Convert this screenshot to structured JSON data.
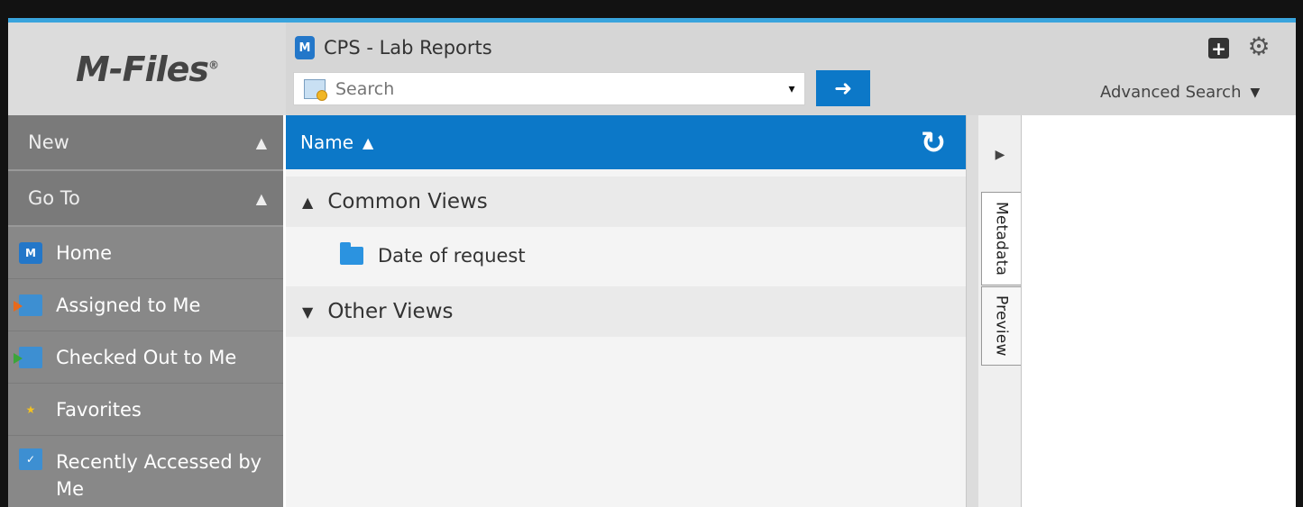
{
  "app": {
    "logo": "M-Files",
    "logo_mark": "®",
    "vault_icon_letter": "M",
    "vault_title": "CPS - Lab Reports"
  },
  "search": {
    "placeholder": "Search",
    "dropdown_glyph": "▾",
    "go_glyph": "➜"
  },
  "header": {
    "add_glyph": "+",
    "settings_glyph": "⚙",
    "advanced_search": "Advanced Search",
    "advanced_caret": "▼"
  },
  "sidebar": {
    "sections": [
      {
        "label": "New",
        "caret": "▲"
      },
      {
        "label": "Go To",
        "caret": "▲"
      }
    ],
    "items": [
      {
        "label": "Home",
        "icon": "vault-home-icon",
        "icon_text": "M"
      },
      {
        "label": "Assigned to Me",
        "icon": "assigned-icon"
      },
      {
        "label": "Checked Out to Me",
        "icon": "checked-out-icon"
      },
      {
        "label": "Favorites",
        "icon": "star-icon",
        "icon_text": "★"
      },
      {
        "label": "Recently Accessed by Me",
        "icon": "recent-icon",
        "icon_text": "✓"
      }
    ]
  },
  "list": {
    "column_header": "Name",
    "sort_caret": "▲",
    "refresh_glyph": "↻",
    "groups": [
      {
        "label": "Common Views",
        "arrow": "▲",
        "views": [
          {
            "label": "Date of request",
            "icon": "folder-icon"
          }
        ]
      },
      {
        "label": "Other Views",
        "arrow": "▼",
        "views": []
      }
    ]
  },
  "right_pane": {
    "expand_glyph": "▶",
    "tabs": [
      {
        "label": "Metadata"
      },
      {
        "label": "Preview"
      }
    ]
  },
  "colors": {
    "accent": "#0c78c8",
    "top_stripe": "#39a4dd",
    "sidebar": "#8c8c8c"
  }
}
